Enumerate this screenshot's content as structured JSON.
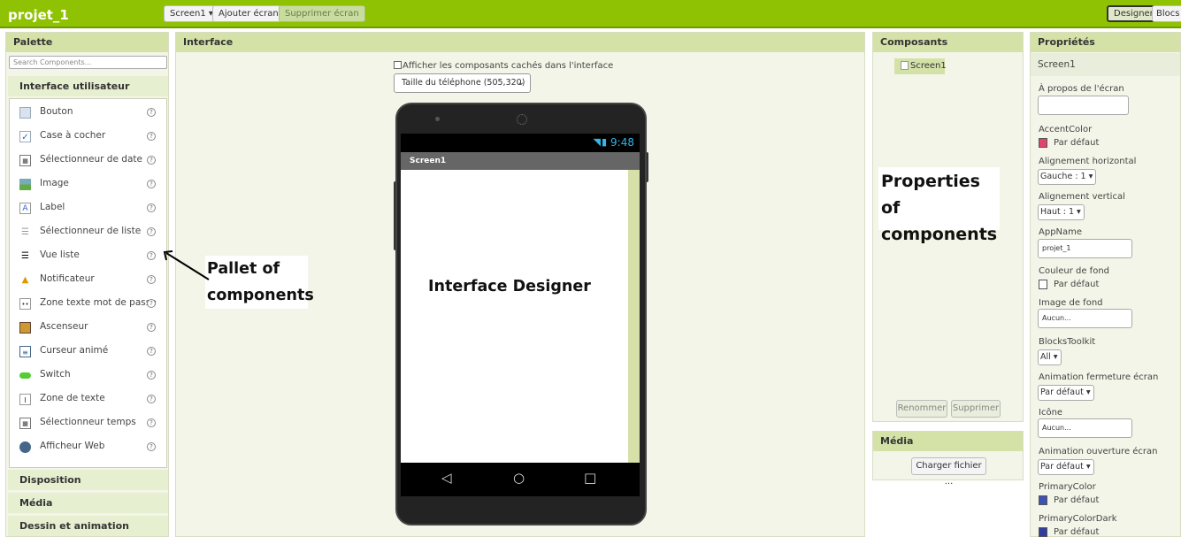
{
  "app": {
    "title": "projet_1"
  },
  "toolbar": {
    "screen_select": "Screen1 ▾",
    "add_screen": "Ajouter écran...",
    "remove_screen": "Supprimer écran",
    "designer": "Designer",
    "blocks": "Blocs"
  },
  "palette": {
    "header": "Palette",
    "search_placeholder": "Search Components...",
    "category_ui": "Interface utilisateur",
    "items": [
      {
        "label": "Bouton",
        "icon": "button-icon"
      },
      {
        "label": "Case à cocher",
        "icon": "checkbox-icon"
      },
      {
        "label": "Sélectionneur de date",
        "icon": "date-picker-icon"
      },
      {
        "label": "Image",
        "icon": "image-icon"
      },
      {
        "label": "Label",
        "icon": "label-icon"
      },
      {
        "label": "Sélectionneur de liste",
        "icon": "list-picker-icon"
      },
      {
        "label": "Vue liste",
        "icon": "list-view-icon"
      },
      {
        "label": "Notificateur",
        "icon": "notifier-icon"
      },
      {
        "label": "Zone texte mot de passe",
        "icon": "password-icon"
      },
      {
        "label": "Ascenseur",
        "icon": "slider-icon"
      },
      {
        "label": "Curseur animé",
        "icon": "spinner-icon"
      },
      {
        "label": "Switch",
        "icon": "switch-icon"
      },
      {
        "label": "Zone de texte",
        "icon": "textbox-icon"
      },
      {
        "label": "Sélectionneur temps",
        "icon": "time-picker-icon"
      },
      {
        "label": "Afficheur Web",
        "icon": "web-viewer-icon"
      }
    ],
    "help": "?",
    "categories": [
      "Disposition",
      "Média",
      "Dessin et animation"
    ]
  },
  "interface": {
    "header": "Interface",
    "show_hidden": "Afficher les composants cachés dans l'interface",
    "size_select": "Taille du téléphone (505,320)",
    "time": "9:48",
    "screen_title": "Screen1",
    "nav_back": "◁",
    "nav_home": "○",
    "nav_recent": "□"
  },
  "components": {
    "header": "Composants",
    "screen1": "Screen1",
    "rename": "Renommer",
    "delete": "Supprimer"
  },
  "media": {
    "header": "Média",
    "upload": "Charger fichier ..."
  },
  "properties": {
    "header": "Propriétés",
    "screen": "Screen1",
    "about": "À propos de l'écran",
    "accent_label": "AccentColor",
    "accent_value": "Par défaut",
    "align_h_label": "Alignement horizontal",
    "align_h_value": "Gauche : 1 ▾",
    "align_v_label": "Alignement vertical",
    "align_v_value": "Haut : 1 ▾",
    "appname_label": "AppName",
    "appname_value": "projet_1",
    "bg_color_label": "Couleur de fond",
    "bg_color_value": "Par défaut",
    "bg_image_label": "Image de fond",
    "bg_image_value": "Aucun...",
    "toolkit_label": "BlocksToolkit",
    "toolkit_value": "All ▾",
    "close_anim_label": "Animation fermeture écran",
    "close_anim_value": "Par défaut ▾",
    "icon_label": "Icône",
    "icon_value": "Aucun...",
    "open_anim_label": "Animation ouverture écran",
    "open_anim_value": "Par défaut ▾",
    "primary_label": "PrimaryColor",
    "primary_value": "Par défaut",
    "primary_dark_label": "PrimaryColorDark",
    "primary_dark_value": "Par défaut"
  },
  "annotations": {
    "palette": "Pallet of components",
    "designer": "Interface Designer",
    "properties": "Properties of components"
  },
  "colors": {
    "brand": "#8fc202",
    "accent": "#e0436e",
    "primary": "#3f51b5",
    "primary_dark": "#303f9f"
  }
}
